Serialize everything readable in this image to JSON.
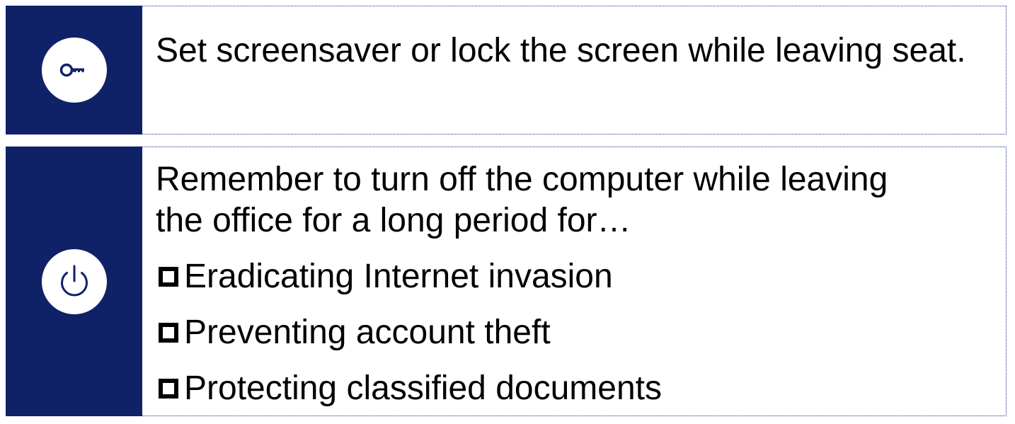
{
  "colors": {
    "sidebar": "#0f2167",
    "border": "#1a2f86",
    "icon": "#0f2167"
  },
  "tips": [
    {
      "icon": "key-icon",
      "text": "Set screensaver or lock the screen while leaving seat."
    },
    {
      "icon": "power-icon",
      "line1": "Remember to turn off the computer while leaving",
      "line2": "the office for a long period for…",
      "bullets": [
        "Eradicating Internet invasion",
        "Preventing account theft",
        "Protecting classified documents"
      ]
    }
  ]
}
